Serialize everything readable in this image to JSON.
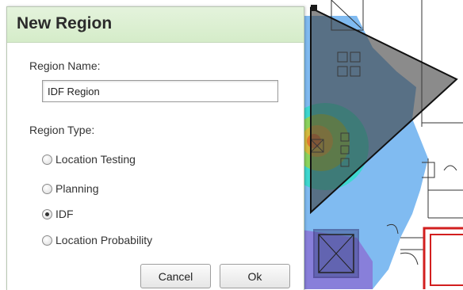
{
  "dialog": {
    "title": "New Region",
    "region_name_label": "Region Name:",
    "region_name_value": "IDF Region",
    "region_type_label": "Region Type:",
    "region_types": [
      {
        "label": "Location Testing",
        "selected": false
      },
      {
        "label": "Planning",
        "selected": false
      },
      {
        "label": "IDF",
        "selected": true
      },
      {
        "label": "Location Probability",
        "selected": false
      }
    ],
    "cancel_label": "Cancel",
    "ok_label": "Ok"
  },
  "colors": {
    "header_green": "#d5ecc9",
    "heatmap_blue": "#6fb1f2",
    "wall_red": "#d21f1f",
    "region_polygon": "#4a4a4a"
  }
}
